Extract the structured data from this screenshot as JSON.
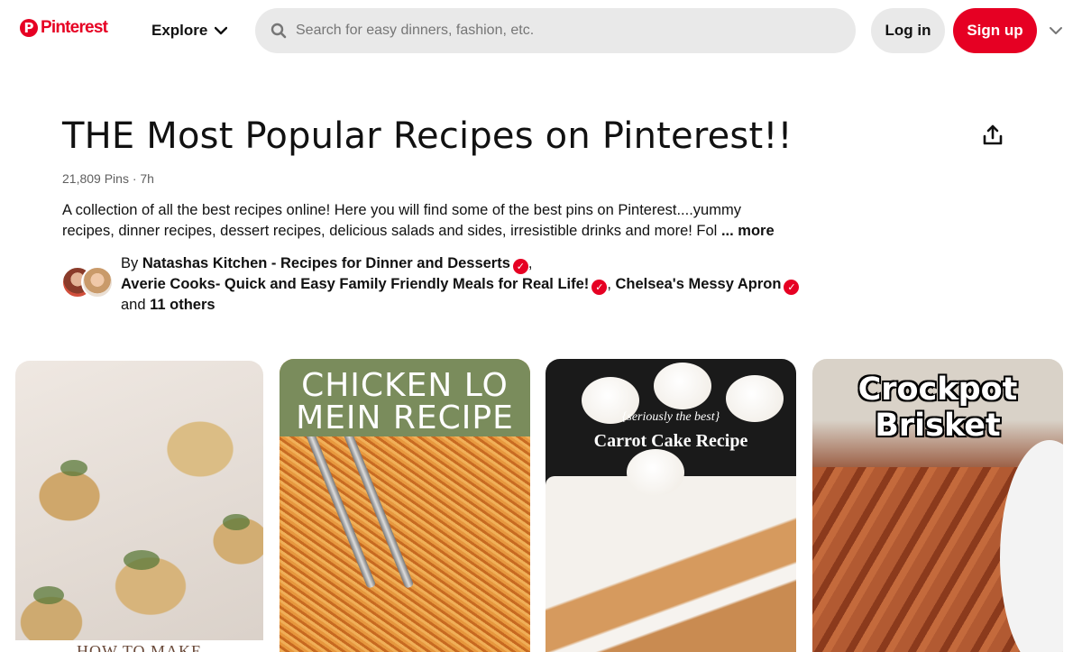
{
  "header": {
    "logo_text": "Pinterest",
    "logo_mark": "P",
    "explore_label": "Explore",
    "search_placeholder": "Search for easy dinners, fashion, etc.",
    "login_label": "Log in",
    "signup_label": "Sign up",
    "brand_color": "#e60023"
  },
  "board": {
    "title": "THE Most Popular Recipes on Pinterest!!",
    "meta": "21,809 Pins · 7h",
    "description": "A collection of all the best recipes online! Here you will find some of the best pins on Pinterest....yummy recipes, dinner recipes, dessert recipes, delicious salads and sides, irresistible drinks and more! Fol",
    "more_label": "... more",
    "by_prefix": "By",
    "collaborators": [
      "Natashas Kitchen - Recipes for Dinner and Desserts",
      "Averie Cooks- Quick and Easy Family Friendly Meals for Real Life!",
      "Chelsea's Messy Apron"
    ],
    "others_prefix": "and",
    "others_count": "11 others",
    "verified_mark": "✓"
  },
  "pins": [
    {
      "caption": "HOW TO MAKE"
    },
    {
      "caption": "CHICKEN LO MEIN RECIPE",
      "line1": "CHICKEN LO",
      "line2": "MEIN RECIPE"
    },
    {
      "kicker": "{seriously the best}",
      "caption": "Carrot Cake Recipe"
    },
    {
      "caption": "Crockpot Brisket",
      "line1": "Crockpot",
      "line2": "Brisket"
    }
  ]
}
